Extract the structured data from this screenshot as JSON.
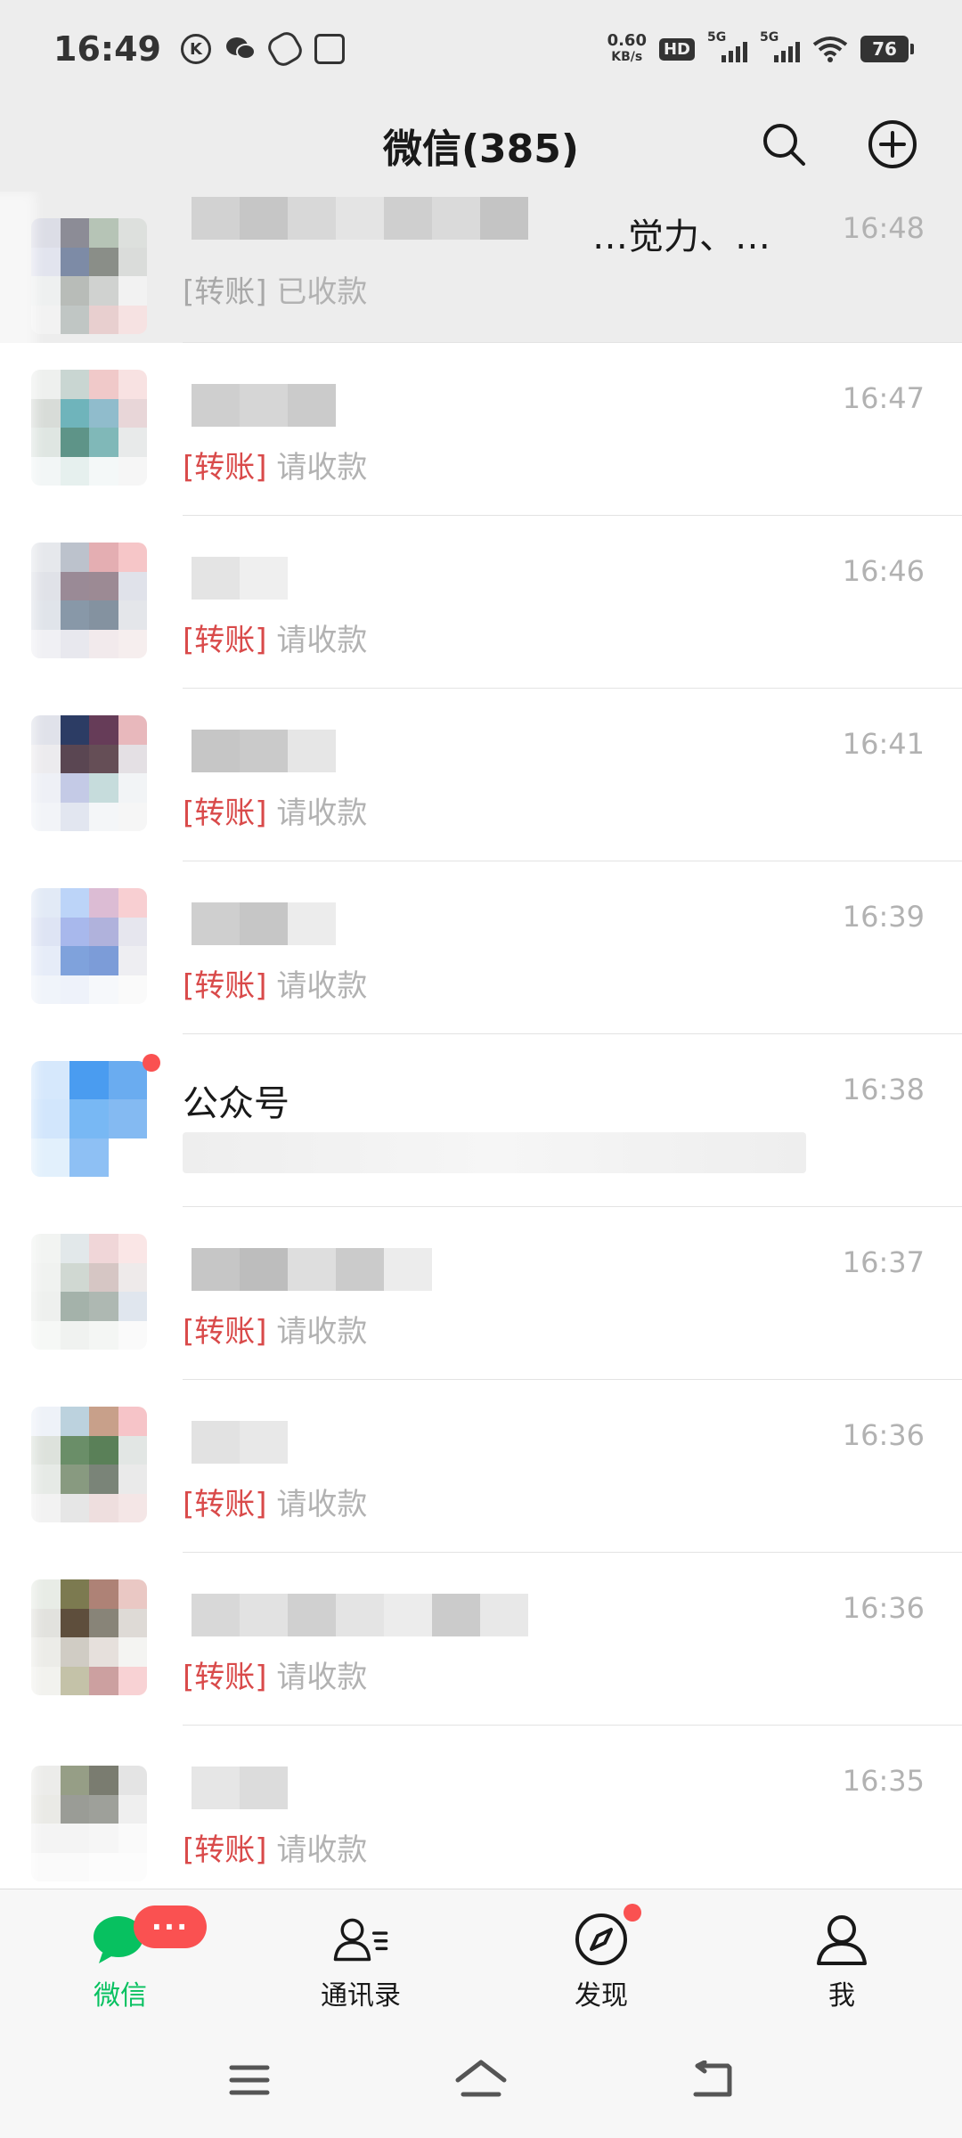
{
  "status_bar": {
    "time": "16:49",
    "net_speed_value": "0.60",
    "net_speed_unit": "KB/s",
    "hd": "HD",
    "signal_1": "5G",
    "signal_2": "5G",
    "battery": "76",
    "left_icons": [
      "k-icon",
      "wechat-icon",
      "app-icon",
      "wallet-icon"
    ]
  },
  "header": {
    "title": "微信(385)",
    "search_icon": "search-icon",
    "add_icon": "plus-circle-icon"
  },
  "chats": [
    {
      "name_visible": "…觉力、…",
      "time": "16:48",
      "tag": "[转账]",
      "tag_style": "gray",
      "preview": "已收款",
      "pinned": true
    },
    {
      "name_visible": "",
      "time": "16:47",
      "tag": "[转账]",
      "tag_style": "red",
      "preview": "请收款"
    },
    {
      "name_visible": "",
      "time": "16:46",
      "tag": "[转账]",
      "tag_style": "red",
      "preview": "请收款"
    },
    {
      "name_visible": "",
      "time": "16:41",
      "tag": "[转账]",
      "tag_style": "red",
      "preview": "请收款"
    },
    {
      "name_visible": "",
      "time": "16:39",
      "tag": "[转账]",
      "tag_style": "red",
      "preview": "请收款"
    },
    {
      "name_visible": "公众号",
      "time": "16:38",
      "tag": "",
      "tag_style": "",
      "preview": "",
      "unread_dot": true
    },
    {
      "name_visible": "",
      "time": "16:37",
      "tag": "[转账]",
      "tag_style": "red",
      "preview": "请收款"
    },
    {
      "name_visible": "",
      "time": "16:36",
      "tag": "[转账]",
      "tag_style": "red",
      "preview": "请收款"
    },
    {
      "name_visible": "",
      "time": "16:36",
      "tag": "[转账]",
      "tag_style": "red",
      "preview": "请收款"
    },
    {
      "name_visible": "",
      "time": "16:35",
      "tag": "[转账]",
      "tag_style": "red",
      "preview": "请收款"
    }
  ],
  "tabs": [
    {
      "label": "微信",
      "icon": "chat-bubble-icon",
      "active": true,
      "badge": "···"
    },
    {
      "label": "通讯录",
      "icon": "contacts-icon",
      "active": false
    },
    {
      "label": "发现",
      "icon": "compass-icon",
      "active": false,
      "dot": true
    },
    {
      "label": "我",
      "icon": "person-icon",
      "active": false
    }
  ],
  "system_nav": [
    "menu-icon",
    "home-icon",
    "back-icon"
  ],
  "colors": {
    "accent_green": "#07c160",
    "badge_red": "#fa5151",
    "transfer_red": "#d94a4a",
    "muted_gray": "#b2b2b2"
  }
}
